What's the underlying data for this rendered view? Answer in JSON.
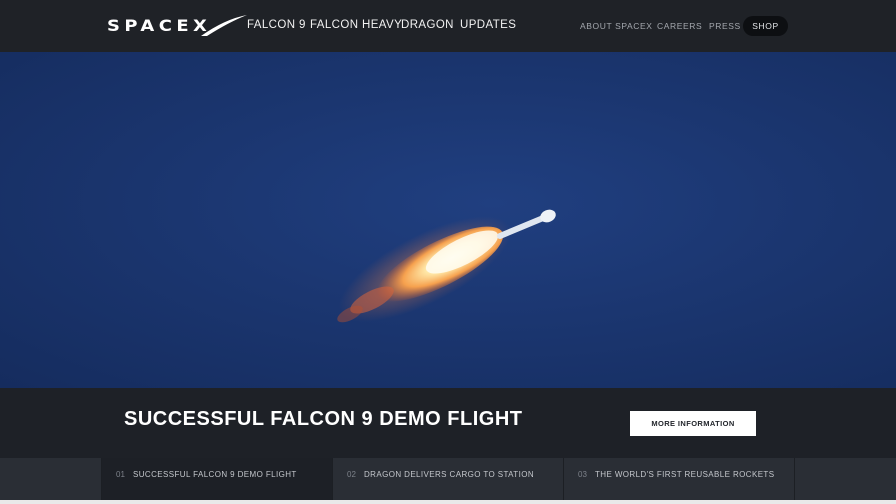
{
  "header": {
    "logo_text": "SPACEX",
    "primary_nav": [
      "FALCON 9",
      "FALCON HEAVY",
      "DRAGON",
      "UPDATES"
    ],
    "secondary_nav": [
      "ABOUT SPACEX",
      "CAREERS",
      "PRESS"
    ],
    "shop_label": "SHOP"
  },
  "hero": {
    "image_icon": "rocket-launch-photo"
  },
  "caption": {
    "headline": "SUCCESSFUL FALCON 9 DEMO FLIGHT",
    "button_label": "MORE INFORMATION"
  },
  "slides": [
    {
      "num": "01",
      "label": "SUCCESSFUL FALCON 9 DEMO FLIGHT"
    },
    {
      "num": "02",
      "label": "DRAGON DELIVERS CARGO TO STATION"
    },
    {
      "num": "03",
      "label": "THE WORLD'S FIRST REUSABLE ROCKETS"
    }
  ],
  "colors": {
    "topbar": "#1f2227",
    "sky": "#1b3670",
    "band": "#1e2127",
    "active_tab": "#1d2026"
  }
}
